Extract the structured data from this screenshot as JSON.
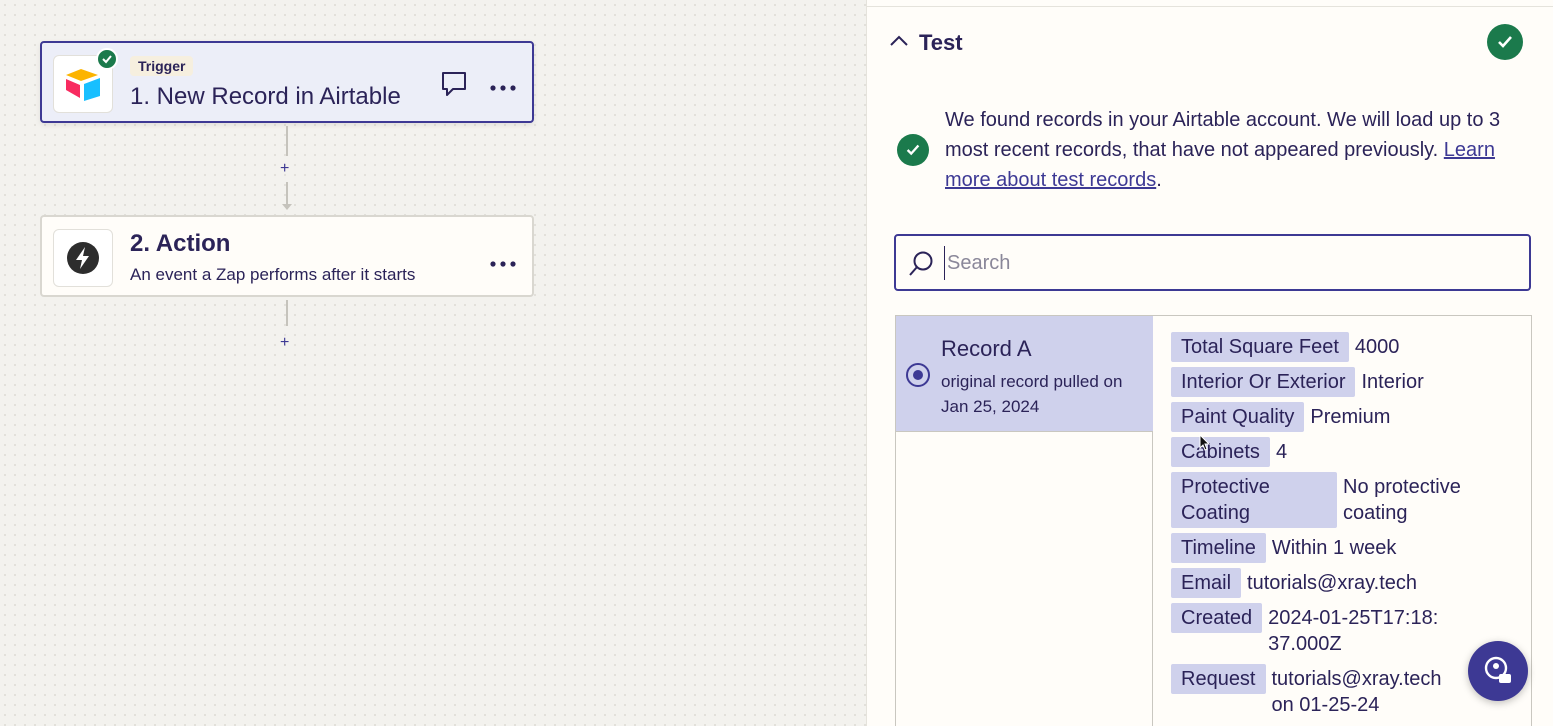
{
  "canvas": {
    "trigger_step": {
      "badge": "Trigger",
      "title": "1. New Record in Airtable"
    },
    "action_step": {
      "title": "2. Action",
      "subtitle": "An event a Zap performs after it starts"
    },
    "plus_label": "+"
  },
  "panel": {
    "section_title": "Test",
    "message_text": "We found records in your Airtable account. We will load up to 3 most recent records, that have not appeared previously. ",
    "message_link": "Learn more about test records",
    "message_end": ".",
    "search_placeholder": "Search",
    "records": [
      {
        "name": "Record A",
        "subtitle": "original record pulled on Jan 25, 2024"
      }
    ],
    "fields": [
      {
        "key": "Total Square Feet",
        "value": "4000"
      },
      {
        "key": "Interior Or Exterior",
        "value": "Interior"
      },
      {
        "key": "Paint Quality",
        "value": "Premium"
      },
      {
        "key": "Cabinets",
        "value": "4"
      },
      {
        "key": "Protective Coating",
        "value": "No protective coating"
      },
      {
        "key": "Timeline",
        "value": "Within 1 week"
      },
      {
        "key": "Email",
        "value": "tutorials@xray.tech"
      },
      {
        "key": "Created",
        "value": "2024-01-25T17:18:37.000Z"
      },
      {
        "key": "Request",
        "value": "tutorials@xray.tech on 01-25-24"
      }
    ]
  },
  "colors": {
    "accent": "#3d3994",
    "success": "#1b7a4c",
    "selected_bg": "#cfd1ec",
    "canvas_bg": "#f3f2ee"
  },
  "icons": {
    "trigger_app": "airtable-logo-icon",
    "action_app": "lightning-bolt-icon",
    "comment": "comment-icon",
    "more": "more-dots-icon",
    "collapse": "chevron-up-icon",
    "search": "search-icon",
    "help": "help-chat-icon"
  }
}
